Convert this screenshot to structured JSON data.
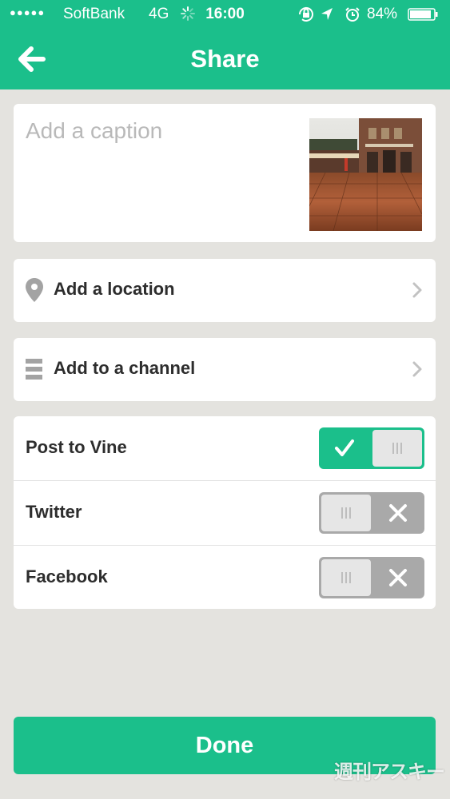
{
  "status_bar": {
    "signal": "●●●●●",
    "carrier": "SoftBank",
    "network": "4G",
    "time": "16:00",
    "battery_percent": "84%"
  },
  "header": {
    "title": "Share",
    "back_icon": "arrow-left-icon"
  },
  "caption": {
    "placeholder": "Add a caption",
    "value": "",
    "thumbnail_alt": "video thumbnail"
  },
  "location": {
    "label": "Add a location",
    "icon": "map-pin-icon"
  },
  "channel": {
    "label": "Add to a channel",
    "icon": "channel-list-icon"
  },
  "share_targets": [
    {
      "label": "Post to Vine",
      "enabled": true
    },
    {
      "label": "Twitter",
      "enabled": false
    },
    {
      "label": "Facebook",
      "enabled": false
    }
  ],
  "done_button": {
    "label": "Done"
  },
  "watermark": "週刊アスキー",
  "colors": {
    "accent": "#1bbf8b",
    "background": "#e4e3df",
    "toggle_off": "#a9a9a9"
  }
}
